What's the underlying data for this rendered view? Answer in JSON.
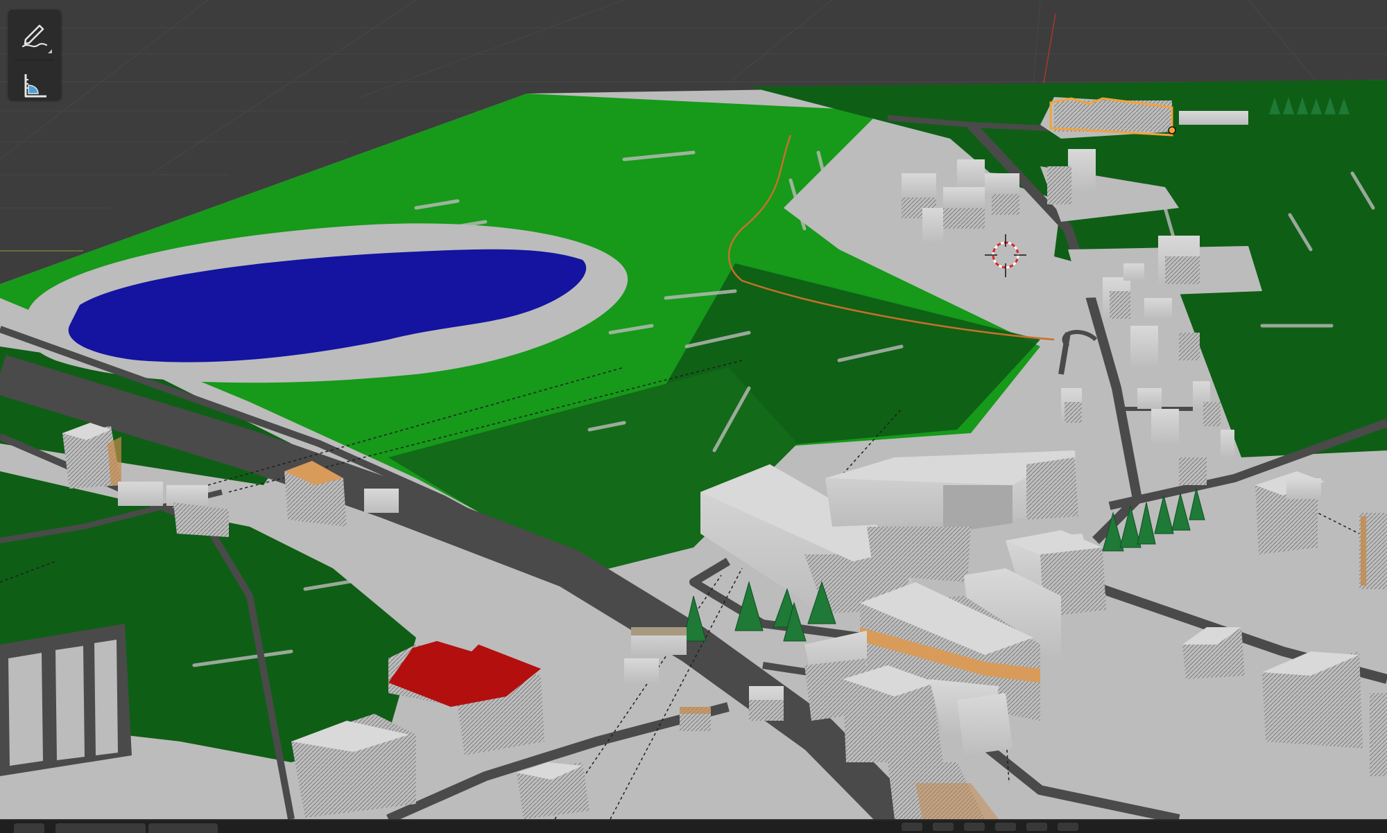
{
  "app": {
    "name": ""
  },
  "toolbar": {
    "tools": [
      {
        "icon": "annotate-pencil-icon"
      },
      {
        "icon": "measure-ruler-icon"
      }
    ]
  },
  "scene": {
    "colors": {
      "background": "#3d3d3d",
      "grid": "#474747",
      "grass_light": "#17991a",
      "grass_dark": "#0f5e16",
      "water": "#1414a0",
      "ground": "#bcbcbc",
      "road": "#4a4a4a",
      "building": "#cfcfcf",
      "roof_red": "#b30f0f",
      "tree": "#1e7a36",
      "selection": "#f2a33a",
      "cursor": "#d42b2b"
    }
  }
}
